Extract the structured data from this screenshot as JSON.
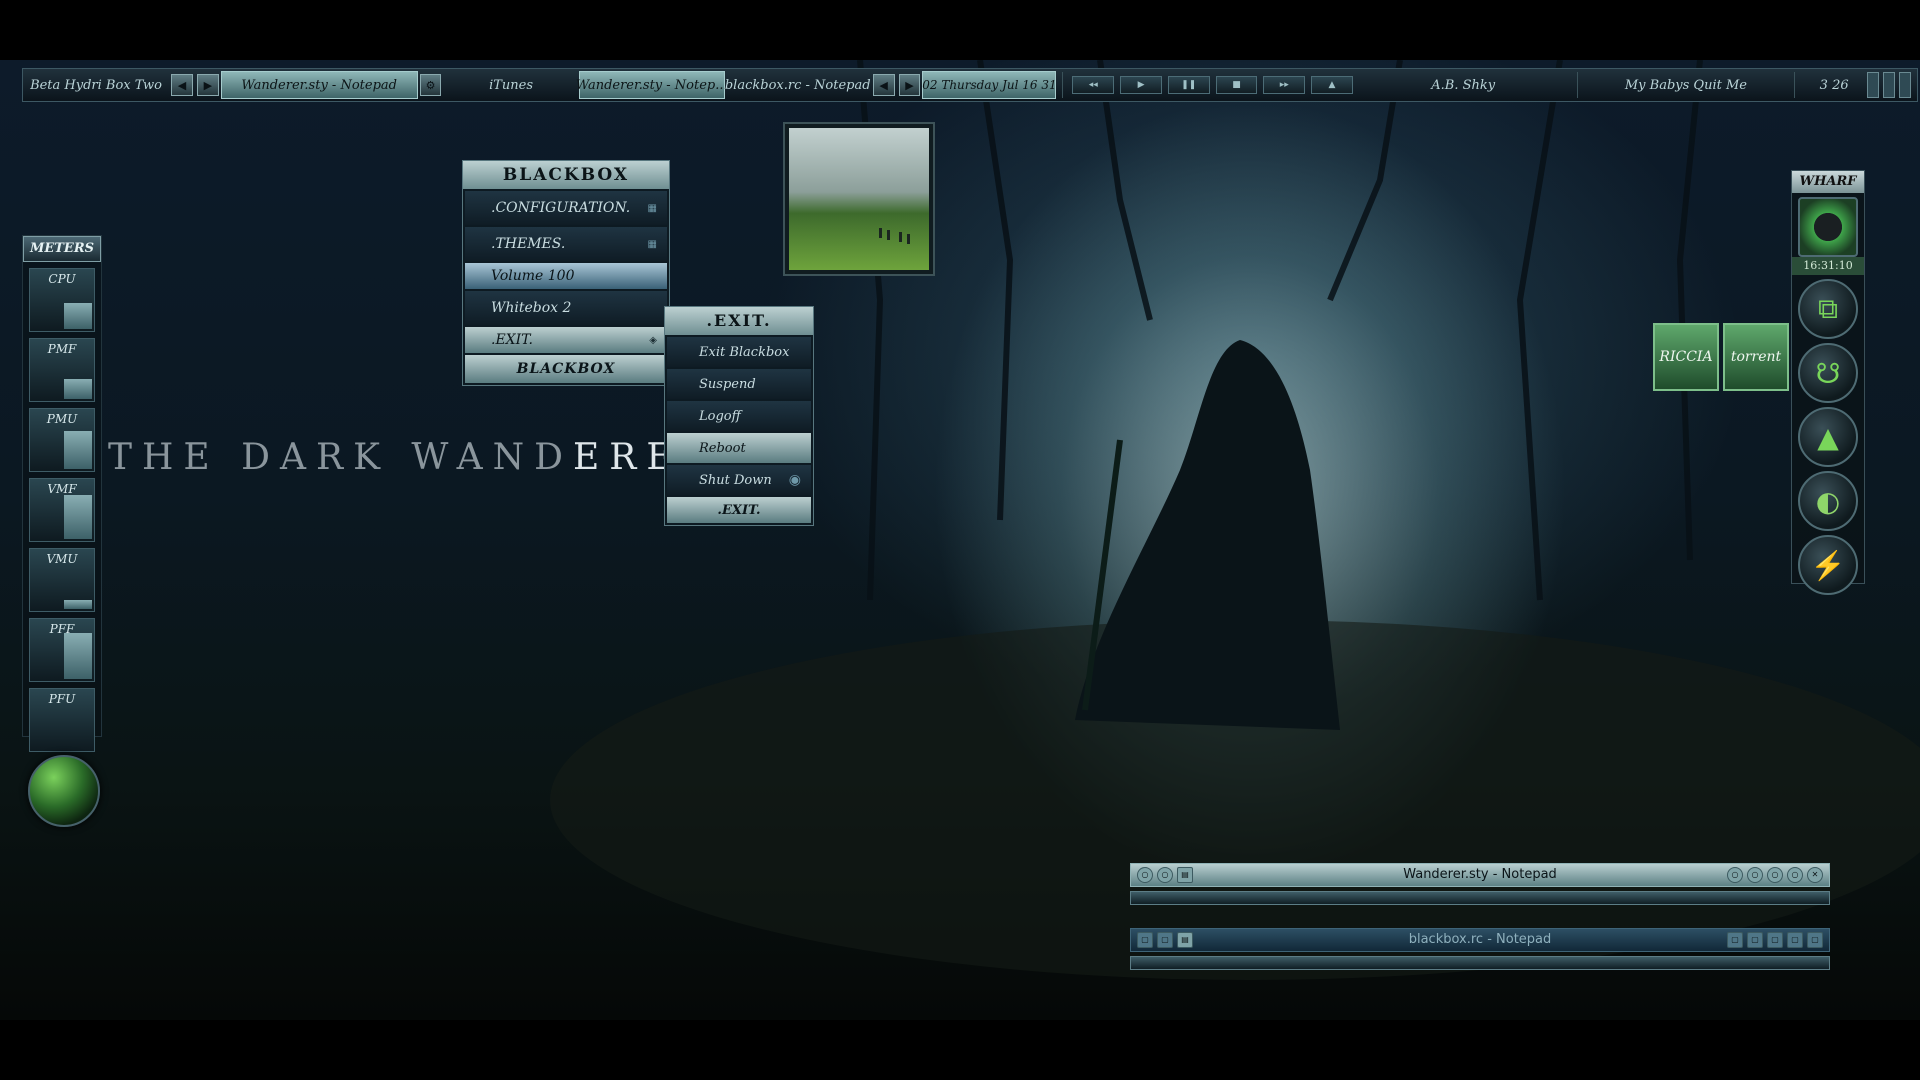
{
  "toolbar": {
    "label": "Beta Hydri Box Two",
    "workspace": "Wanderer.sty - Notepad",
    "tasks": [
      "iTunes",
      "Wanderer.sty - Notep...",
      "blackbox.rc - Notepad"
    ],
    "clock": "02 Thursday Jul 16 31",
    "player_buttons": [
      "◂◂",
      "▶",
      "❚❚",
      "■",
      "▸▸",
      "▲"
    ],
    "artist": "A.B. Shky",
    "song": "My Babys Quit Me",
    "time": "3 26"
  },
  "desktop_title": {
    "dim": "THE DARK WAND",
    "bright": "ERER"
  },
  "meters": {
    "header": "METERS",
    "items": [
      {
        "label": "CPU",
        "level": 0.45
      },
      {
        "label": "PMF",
        "level": 0.35
      },
      {
        "label": "PMU",
        "level": 0.65
      },
      {
        "label": "VMF",
        "level": 0.75
      },
      {
        "label": "VMU",
        "level": 0.15
      },
      {
        "label": "PFF",
        "level": 0.8
      },
      {
        "label": "PFU",
        "level": 0.0
      }
    ]
  },
  "blackbox_menu": {
    "title": "BLACKBOX",
    "items": [
      ".CONFIGURATION.",
      ".THEMES.",
      "Volume 100",
      "Whitebox 2",
      ".EXIT."
    ],
    "footer": "BLACKBOX"
  },
  "exit_menu": {
    "title": ".EXIT.",
    "items": [
      "Exit Blackbox",
      "Suspend",
      "Logoff",
      "Reboot",
      "Shut Down"
    ],
    "footer": ".EXIT."
  },
  "dock": {
    "header": "WHARF",
    "clock": "16:31:10",
    "icons": [
      "circle-icon",
      "square-arrow-icon",
      "swirl-icon",
      "triangle-icon",
      "orb-icon",
      "bolt-icon"
    ]
  },
  "tiles": [
    "RICCIA",
    "torrent"
  ],
  "windows": [
    {
      "title": "Wanderer.sty - Notepad",
      "active": true
    },
    {
      "title": "blackbox.rc - Notepad",
      "active": false
    }
  ],
  "colors": {
    "accent": "#7fa3a7",
    "highlight": "#79d65a",
    "bg": "#0b1822"
  }
}
